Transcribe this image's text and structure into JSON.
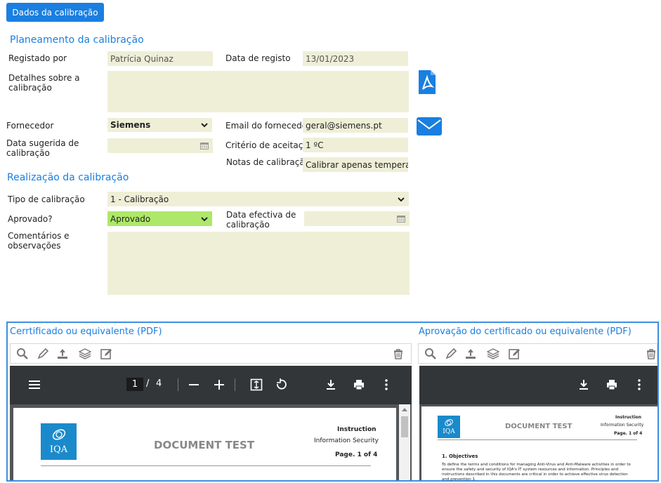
{
  "top_button": "Dados da calibração",
  "planning": {
    "title": "Planeamento da calibração",
    "registered_by_label": "Registado por",
    "registered_by_value": "Patrícia Quinaz",
    "register_date_label": "Data de registo",
    "register_date_value": "13/01/2023",
    "details_label": "Detalhes sobre a calibração",
    "details_value": "",
    "supplier_label": "Fornecedor",
    "supplier_value": "Siemens",
    "supplier_email_label": "Email do fornecedor",
    "supplier_email_value": "geral@siemens.pt",
    "suggested_date_label": "Data sugerida de calibração",
    "suggested_date_value": "",
    "acceptance_label": "Critério de aceitação",
    "acceptance_value": "1 ºC",
    "notes_label": "Notas de calibração",
    "notes_value": "Calibrar apenas temperatura"
  },
  "execution": {
    "title": "Realização da calibração",
    "type_label": "Tipo de calibração",
    "type_value": "1 - Calibração",
    "approved_label": "Aprovado?",
    "approved_value": "Aprovado",
    "effective_date_label": "Data efectiva de calibração",
    "effective_date_value": "",
    "comments_label": "Comentários e observações",
    "comments_value": ""
  },
  "pdf_left": {
    "title": "Cerrtificado ou equivalente (PDF)",
    "page_current": "1",
    "page_sep": "/",
    "page_total": "4",
    "doc": {
      "logo_text": "IQA",
      "heading": "DOCUMENT TEST",
      "meta1": "Instruction",
      "meta2": "Information Security",
      "meta3": "Page. 1 of 4"
    }
  },
  "pdf_right": {
    "title": "Aprovação do certificado ou equivalente (PDF)",
    "doc": {
      "logo_text": "IQA",
      "heading": "DOCUMENT TEST",
      "meta1": "Instruction",
      "meta2": "Information Security",
      "meta3": "Page. 1 of 4",
      "section": "1. Objectives",
      "body": "To define the terms and conditions for managing Anti-Virus and Anti-Malware activities in order to ensure the safety and security of IQA's IT system resources and information. Principles and instructions described in this documents are critical in order to achieve effective virus detection and prevention 1"
    }
  },
  "colors": {
    "accent": "#1a7fe0",
    "field_bg": "#efefd8",
    "approved_bg": "#aee86a",
    "viewer_bar": "#323639"
  },
  "icons": [
    "pdf-icon",
    "mail-icon",
    "calendar-icon",
    "chevron-down-icon",
    "search-icon",
    "pencil-icon",
    "upload-icon",
    "layers-icon",
    "edit-icon",
    "trash-icon",
    "menu-icon",
    "minus-icon",
    "plus-icon",
    "fit-page-icon",
    "rotate-icon",
    "download-icon",
    "print-icon",
    "more-icon"
  ]
}
